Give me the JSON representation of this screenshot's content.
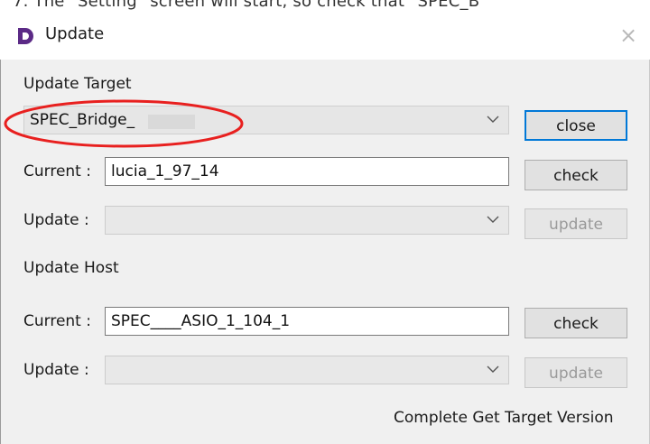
{
  "background_instruction": "7. The \"Setting\" screen will start, so check that \"SPEC_B",
  "window": {
    "title": "Update",
    "close_glyph": "×"
  },
  "update_target": {
    "section_label": "Update Target",
    "target_select_value": "SPEC_Bridge_",
    "close_button": "close",
    "current_label": "Current :",
    "current_value": "lucia_1_97_14",
    "check_button": "check",
    "update_label": "Update :",
    "update_select_value": "",
    "update_button": "update"
  },
  "update_host": {
    "section_label": "Update Host",
    "current_label": "Current :",
    "current_value": "SPEC____ASIO_1_104_1",
    "check_button": "check",
    "update_label": "Update :",
    "update_select_value": "",
    "update_button": "update"
  },
  "status_text": "Complete Get Target Version",
  "colors": {
    "accent": "#0078d7",
    "annotation_circle": "#e8201f",
    "logo": "#5b2a86"
  },
  "icons": {
    "logo": "app-logo-icon",
    "close": "close-icon",
    "dropdown": "chevron-down-icon"
  }
}
